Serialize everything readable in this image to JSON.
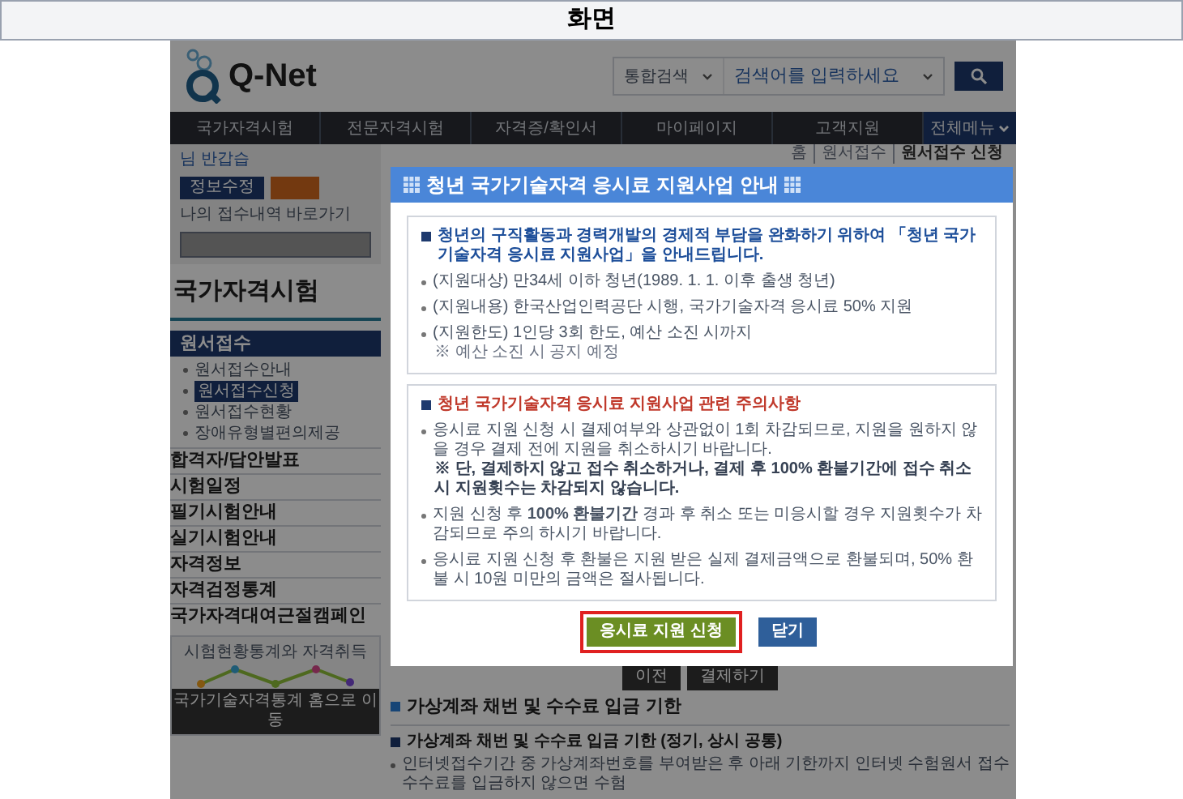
{
  "screen_title": "화면",
  "header": {
    "logo": "Q-Net",
    "search_scope": "통합검색",
    "search": {
      "placeholder": "검색어를 입력하세요"
    }
  },
  "nav": [
    {
      "label": "국가자격시험",
      "kind": "menu"
    },
    {
      "label": "전문자격시험",
      "kind": "menu"
    },
    {
      "label": "자격증/확인서",
      "kind": "menu"
    },
    {
      "label": "마이페이지",
      "kind": "menu"
    },
    {
      "label": "고객지원",
      "kind": "menu"
    },
    {
      "label": "전체메뉴",
      "kind": "all"
    }
  ],
  "breadcrumb": [
    "홈",
    "원서접수",
    "원서접수 신청"
  ],
  "sidebar": {
    "greeting": "님 반갑습",
    "buttons": [
      "정보수정"
    ],
    "link": "나의 접수내역 바로가기",
    "heading": "국가자격시험",
    "section": "원서접수",
    "sub_items": [
      {
        "label": "원서접수안내",
        "selected": false
      },
      {
        "label": "원서접수신청",
        "selected": true
      },
      {
        "label": "원서접수현황",
        "selected": false
      },
      {
        "label": "장애유형별편의제공",
        "selected": false
      }
    ],
    "menu": [
      "합격자/답안발표",
      "시험일정",
      "필기시험안내",
      "실기시험안내",
      "자격정보",
      "자격검정통계",
      "국가자격대여근절캠페인"
    ],
    "banner": {
      "caption": "시험현황통계와 자격취득",
      "button": "국가기술자격통계 홈으로 이동"
    }
  },
  "content": {
    "buttons": [
      "이전",
      "결제하기"
    ],
    "section_title": "가상계좌 채번 및 수수료 입금 기한",
    "subsection_title": "가상계좌 채번 및 수수료 입금 기한 (정기, 상시 공통)",
    "bullet": "인터넷접수기간 중 가상계좌번호를 부여받은 후 아래 기한까지 인터넷 수험원서 접수 수수료를 입금하지 않으면 수험"
  },
  "dialog": {
    "title": "청년 국가기술자격 응시료 지원사업 안내",
    "intro": {
      "heading": "청년의 구직활동과 경력개발의 경제적 부담을 완화하기 위하여 「청년 국가기술자격 응시료 지원사업」을 안내드립니다.",
      "items": [
        {
          "text": "(지원대상) 만34세 이하 청년(1989. 1. 1. 이후 출생 청년)"
        },
        {
          "text": "(지원내용) 한국산업인력공단 시행, 국가기술자격 응시료 50% 지원"
        },
        {
          "text": "(지원한도) 1인당 3회 한도, 예산 소진 시까지",
          "note": {
            "text": "※ 예산 소진 시 공지 예정",
            "bold": false
          }
        }
      ]
    },
    "cautions": {
      "heading": "청년 국가기술자격 응시료 지원사업 관련 주의사항",
      "items": [
        {
          "text": "응시료 지원 신청 시 결제여부와 상관없이 1회 차감되므로, 지원을 원하지 않을 경우 결제 전에 지원을 취소하시기 바랍니다.",
          "note": {
            "text": "※ 단, 결제하지 않고 접수 취소하거나, 결제 후 100% 환불기간에 접수 취소 시 지원횟수는 차감되지 않습니다.",
            "bold": true
          }
        },
        {
          "text": "지원 신청 후 **100% 환불기간** 경과 후 취소 또는 미응시할 경우 지원횟수가 차감되므로 주의 하시기 바랍니다."
        },
        {
          "text": "응시료 지원 신청 후 환불은 지원 받은 실제 결제금액으로 환불되며, 50% 환불 시 10원 미만의 금액은 절사됩니다."
        }
      ]
    },
    "buttons": [
      {
        "label": "응시료 지원 신청",
        "kind": "primary",
        "highlighted": true
      },
      {
        "label": "닫기",
        "kind": "secondary",
        "highlighted": false
      }
    ]
  }
}
